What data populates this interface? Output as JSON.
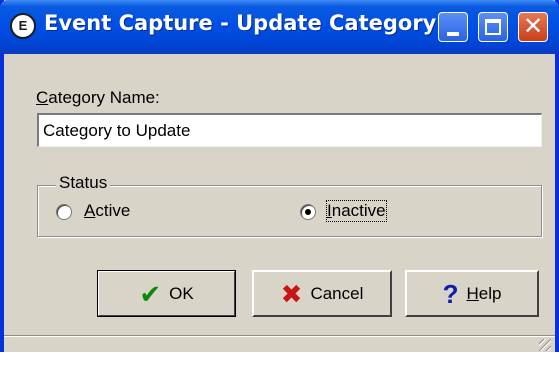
{
  "window": {
    "title": "Event Capture - Update Category",
    "app_icon_glyph": "E",
    "icons": {
      "minimize": "minimize-icon",
      "maximize": "maximize-icon",
      "close": "close-icon",
      "close_glyph": "✕"
    }
  },
  "form": {
    "category_label_first": "C",
    "category_label_rest": "ategory Name:",
    "category_value": "Category to Update",
    "status": {
      "legend": "Status",
      "options": [
        {
          "underline": "A",
          "rest": "ctive",
          "selected": false
        },
        {
          "underline": "I",
          "rest": "nactive",
          "selected": true
        }
      ]
    }
  },
  "buttons": {
    "ok_label": "OK",
    "ok_icon": "✔",
    "cancel_label": "Cancel",
    "cancel_icon": "✖",
    "help_underline": "H",
    "help_rest": "elp",
    "help_icon": "?"
  },
  "colors": {
    "titlebar": "#0050e6",
    "dialog_bg": "#d8d4c8",
    "ok_icon": "#0a8a0a",
    "cancel_icon": "#c81414",
    "help_icon": "#0c1cb0"
  }
}
